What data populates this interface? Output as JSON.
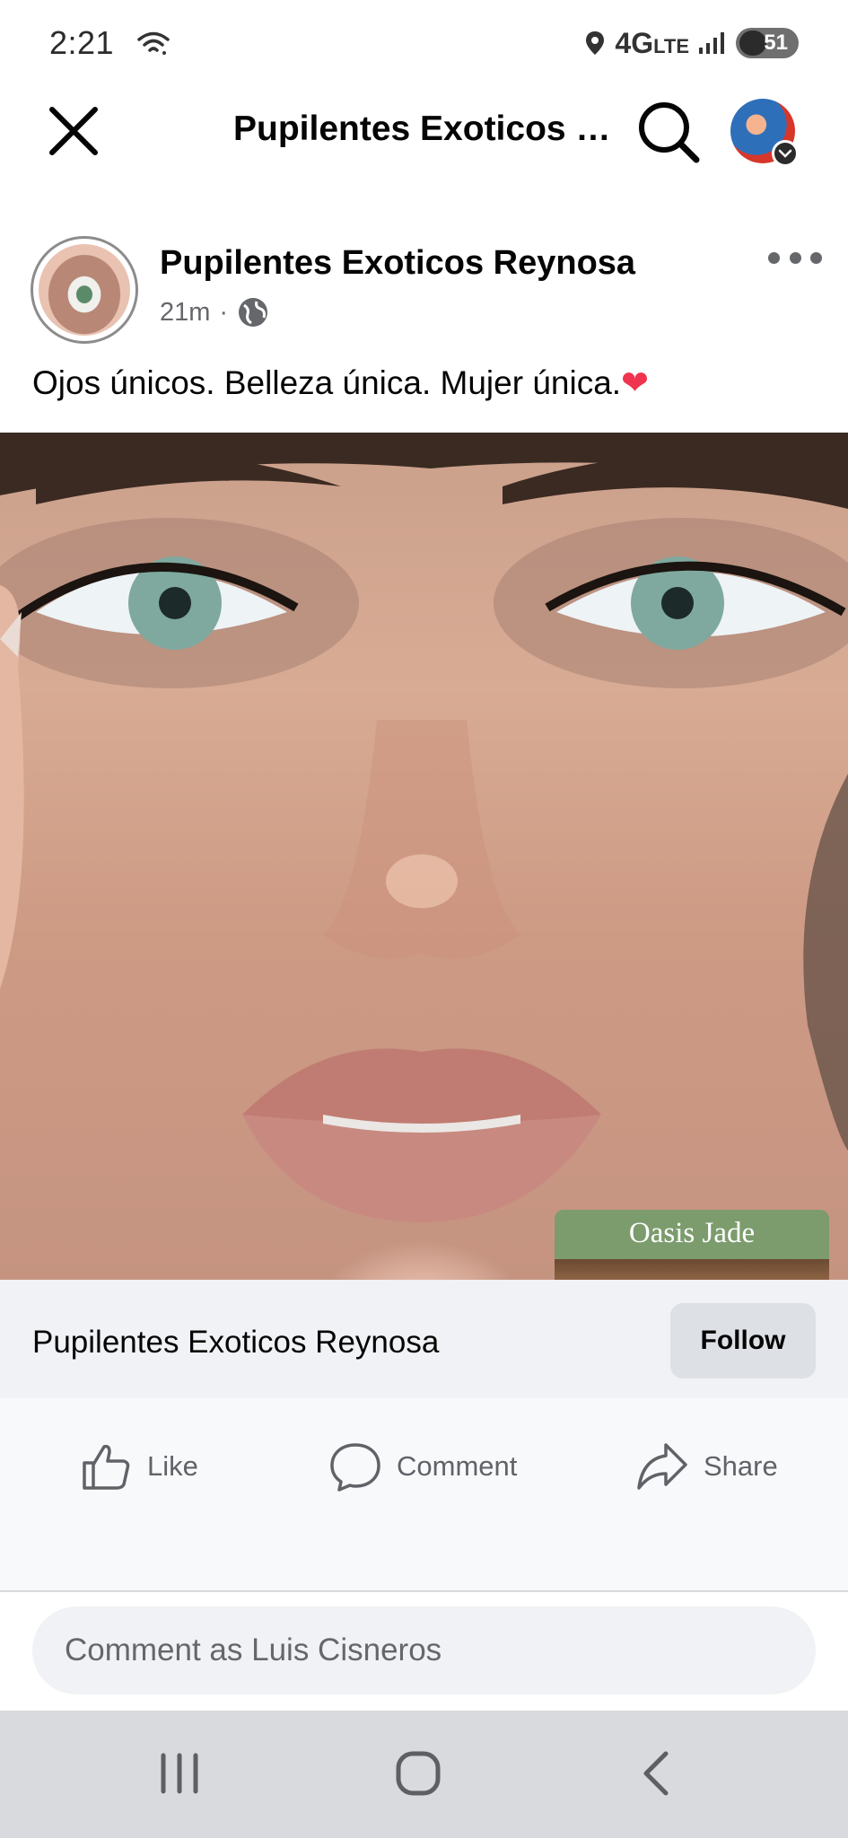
{
  "status_bar": {
    "time": "2:21",
    "network": "4G",
    "network_sub": "LTE",
    "battery": "51",
    "icons": [
      "wifi-icon",
      "location-icon",
      "signal-icon",
      "battery-icon"
    ]
  },
  "header": {
    "title": "Pupilentes Exoticos Reynosa",
    "icons": [
      "close-icon",
      "search-icon",
      "profile-avatar"
    ]
  },
  "post": {
    "author": "Pupilentes Exoticos Reynosa",
    "time": "21m",
    "separator": "·",
    "privacy_icon": "globe-icon",
    "text": "Ojos únicos. Belleza única. Mujer única.",
    "emoji": "❤",
    "image": {
      "inset_label": "Oasis Jade"
    }
  },
  "follow_bar": {
    "page_name": "Pupilentes Exoticos Reynosa",
    "follow_label": "Follow"
  },
  "actions": {
    "like": "Like",
    "comment": "Comment",
    "share": "Share"
  },
  "comment_box": {
    "placeholder": "Comment as Luis Cisneros"
  },
  "colors": {
    "accent_text": "#050505",
    "secondary_text": "#65676b",
    "follow_bar_bg": "#f0f2f5",
    "nav_bg": "#d9dadd"
  }
}
